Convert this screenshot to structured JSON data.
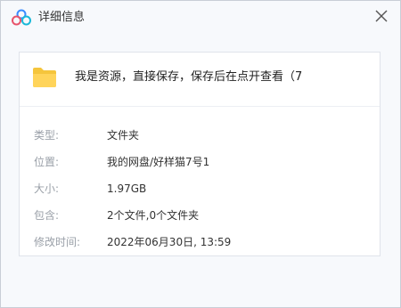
{
  "window": {
    "title": "详细信息",
    "app_icon": "baidu-netdisk-cloud-icon",
    "close_icon": "close-icon"
  },
  "file": {
    "icon": "folder-icon",
    "icon_color": "#F5C53C",
    "name": "我是资源，直接保存，保存后在点开查看（7"
  },
  "details": [
    {
      "label": "类型:",
      "value": "文件夹"
    },
    {
      "label": "位置:",
      "value": "我的网盘/好样猫7号1"
    },
    {
      "label": "大小:",
      "value": "1.97GB"
    },
    {
      "label": "包含:",
      "value": "2个文件,0个文件夹"
    },
    {
      "label": "修改时间:",
      "value": "2022年06月30日, 13:59"
    }
  ]
}
